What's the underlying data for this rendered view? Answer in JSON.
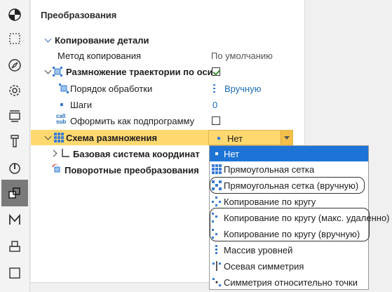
{
  "toolbar": {
    "icons": [
      "pie-icon",
      "dotted-square-icon",
      "compass-icon",
      "gear-icon",
      "frame-icon",
      "tool-icon",
      "drop-icon",
      "transform-icon",
      "m-icon",
      "stack-icon",
      "square-icon"
    ],
    "active_index": 7
  },
  "panel": {
    "title": "Преобразования",
    "copy_section": "Копирование детали",
    "copy_method_label": "Метод копирования",
    "copy_method_value": "По умолчанию",
    "trajectory_multiply_label": "Размножение траектории по оси",
    "trajectory_multiply_checked": true,
    "processing_order_label": "Порядок обработки",
    "processing_order_value": "Вручную",
    "steps_label": "Шаги",
    "steps_value": "0",
    "subprogram_icon_text": "call sub",
    "subprogram_label": "Оформить как подпрограмму",
    "subprogram_checked": false,
    "scheme_label": "Схема размножения",
    "scheme_value": "Нет",
    "base_cs_label": "Базовая система координат",
    "rotations_label": "Поворотные преобразования"
  },
  "dropdown": {
    "options": [
      "Нет",
      "Прямоугольная сетка",
      "Прямоугольная сетка (вручную)",
      "Копирование по кругу",
      "Копирование по кругу (макс. удаленно)",
      "Копирование по кругу (вручную)",
      "Массив уровней",
      "Осевая симметрия",
      "Симметрия относительно точки"
    ],
    "selected_index": 0
  },
  "colors": {
    "accent": "#1e74d6",
    "selected_row": "#ffd970",
    "link_value": "#1a6bb5"
  }
}
